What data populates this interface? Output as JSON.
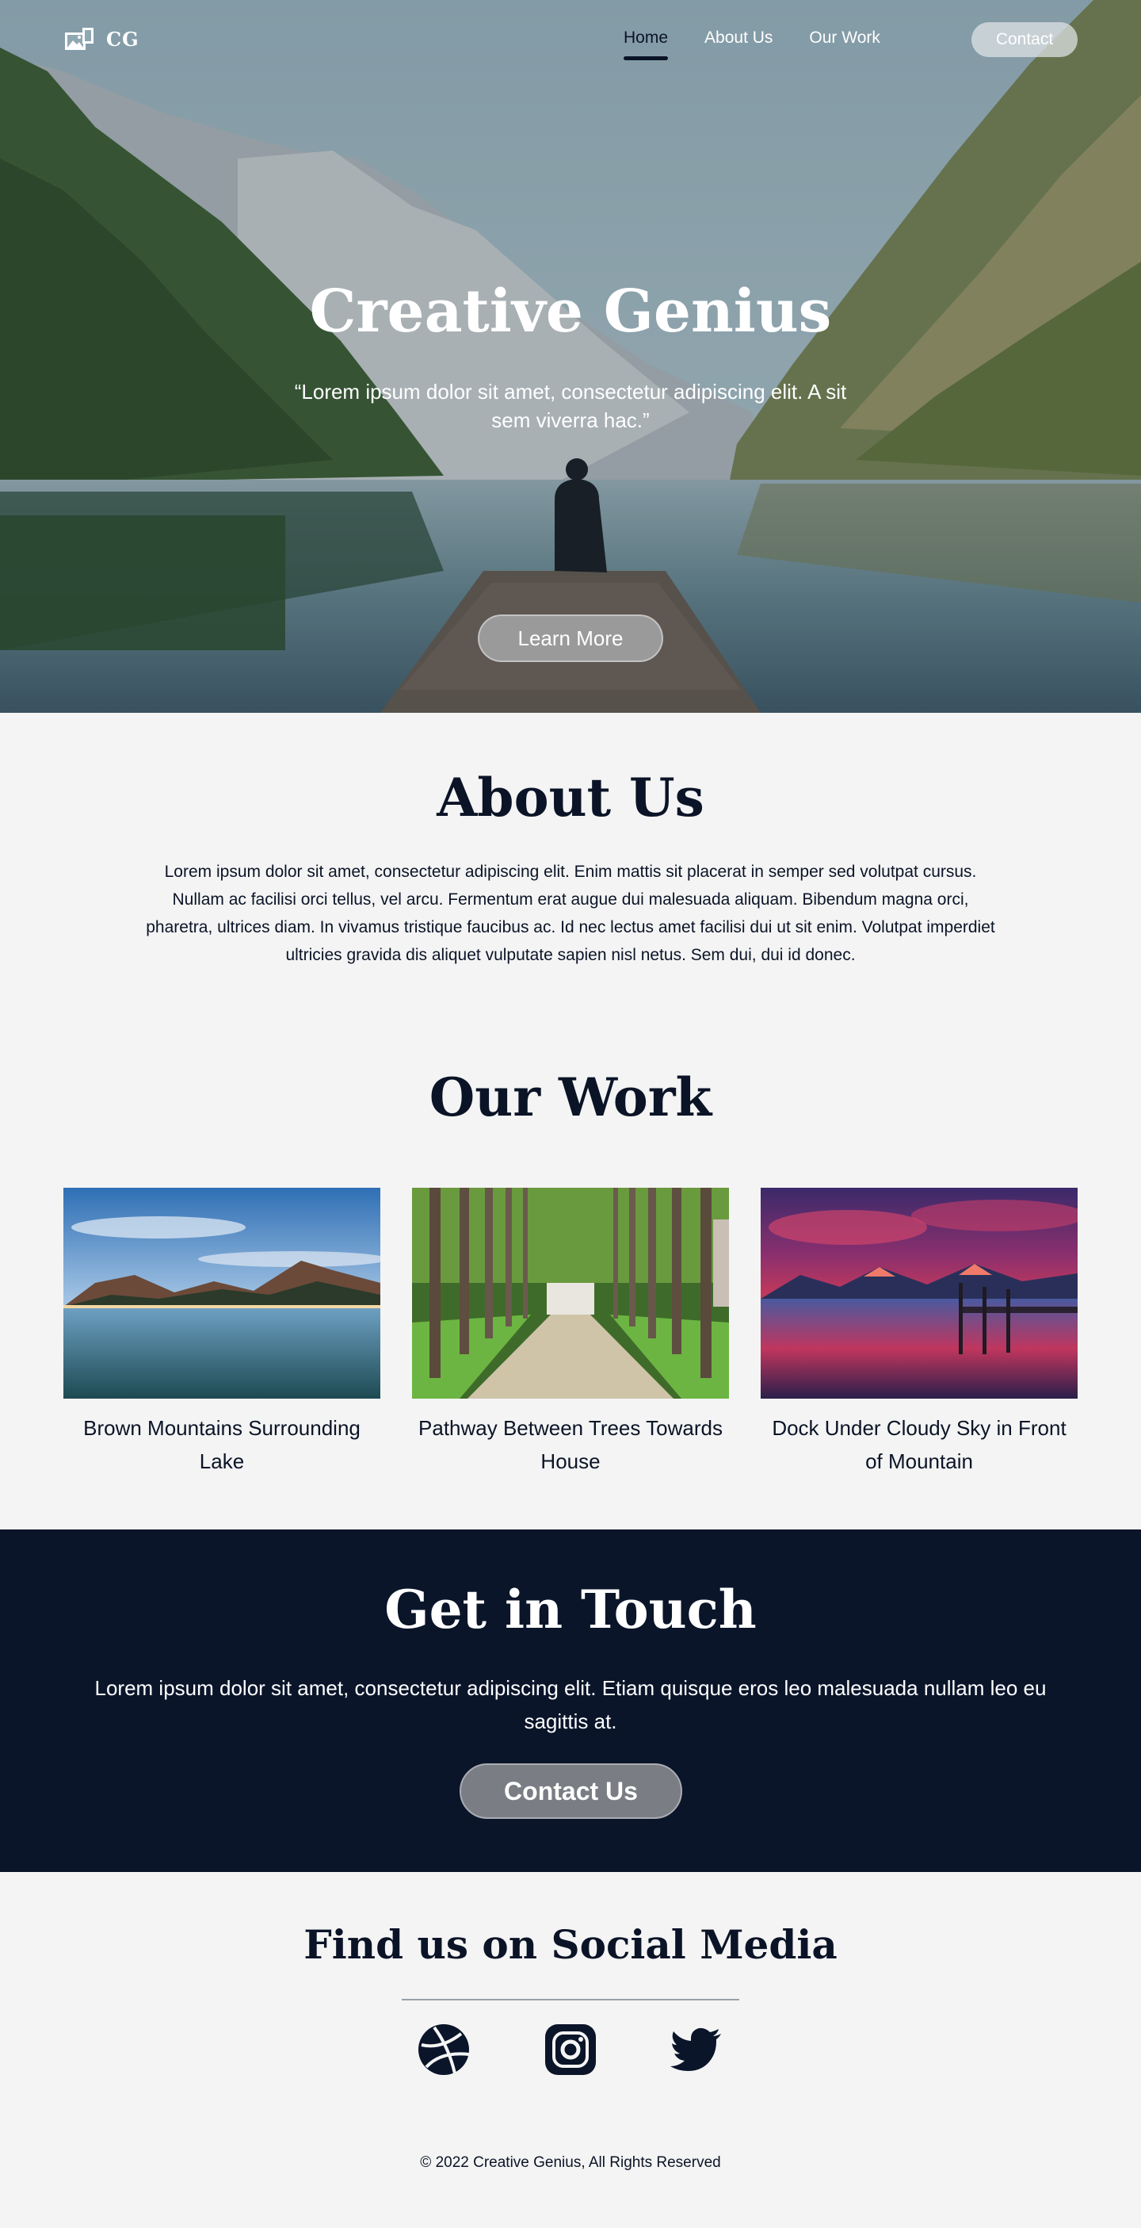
{
  "nav": {
    "logo_text": "CG",
    "links": [
      {
        "label": "Home",
        "active": true
      },
      {
        "label": "About Us",
        "active": false
      },
      {
        "label": "Our Work",
        "active": false
      }
    ],
    "contact_label": "Contact"
  },
  "hero": {
    "title": "Creative Genius",
    "quote": "“Lorem ipsum dolor sit amet, consectetur adipiscing elit. A sit sem viverra hac.”",
    "button_label": "Learn More"
  },
  "about": {
    "title": "About Us",
    "text": "Lorem ipsum dolor sit amet, consectetur adipiscing elit. Enim mattis sit placerat in semper sed volutpat cursus. Nullam ac facilisi orci tellus, vel arcu. Fermentum erat augue dui malesuada aliquam. Bibendum magna orci, pharetra, ultrices diam. In vivamus tristique faucibus ac. Id nec lectus amet facilisi dui ut sit enim. Volutpat imperdiet ultricies gravida dis aliquet vulputate sapien nisl netus. Sem dui, dui id donec."
  },
  "work": {
    "title": "Our Work",
    "items": [
      {
        "caption": "Brown Mountains Surrounding Lake"
      },
      {
        "caption": "Pathway Between Trees Towards House"
      },
      {
        "caption": "Dock Under Cloudy Sky in Front of Mountain"
      }
    ]
  },
  "contact": {
    "title": "Get in Touch",
    "text": "Lorem ipsum dolor sit amet, consectetur adipiscing elit. Etiam quisque eros leo malesuada nullam leo eu sagittis at.",
    "button_label": "Contact Us"
  },
  "social": {
    "title": "Find us on Social Media",
    "icons": [
      "dribbble-icon",
      "instagram-icon",
      "twitter-icon"
    ]
  },
  "footer": {
    "copyright": "© 2022 Creative Genius, All Rights Reserved"
  },
  "colors": {
    "navy": "#0a152a",
    "background": "#f4f4f4",
    "button_gray": "#7a7d84"
  }
}
